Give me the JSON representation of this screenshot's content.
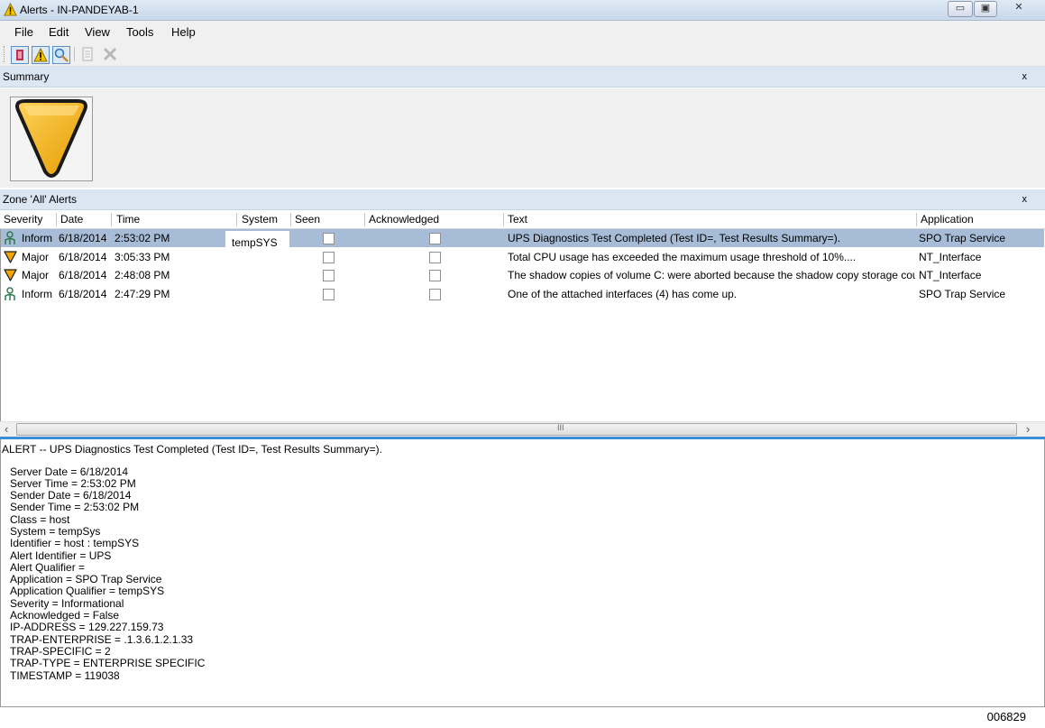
{
  "window": {
    "title": "Alerts - IN-PANDEYAB-1"
  },
  "menu": [
    "File",
    "Edit",
    "View",
    "Tools",
    "Help"
  ],
  "summary": {
    "title": "Summary",
    "close": "x"
  },
  "alerts_panel": {
    "title": "Zone 'All' Alerts",
    "close": "x"
  },
  "columns": [
    "Severity",
    "Date",
    "Time",
    "System",
    "Seen",
    "Acknowledged",
    "Text",
    "Application"
  ],
  "rows": [
    {
      "severity": "Inform",
      "date": "6/18/2014",
      "time": "2:53:02 PM",
      "system": "tempSYS",
      "text": "UPS Diagnostics Test Completed (Test ID=, Test Results Summary=).",
      "application": "SPO Trap Service",
      "selected": true
    },
    {
      "severity": "Major",
      "date": "6/18/2014",
      "time": "3:05:33 PM",
      "system": "",
      "text": "Total CPU usage has exceeded the maximum usage threshold of 10%....",
      "application": "NT_Interface",
      "selected": false
    },
    {
      "severity": "Major",
      "date": "6/18/2014",
      "time": "2:48:08 PM",
      "system": "",
      "text": "The shadow copies of volume C: were aborted because the shadow copy storage coul...",
      "application": "NT_Interface",
      "selected": false
    },
    {
      "severity": "Inform",
      "date": "6/18/2014",
      "time": "2:47:29 PM",
      "system": "",
      "text": "One of the attached interfaces (4) has come up.",
      "application": "SPO Trap Service",
      "selected": false
    }
  ],
  "scroll": {
    "left": "‹",
    "right": "›",
    "grip": "III"
  },
  "detail": {
    "header": "ALERT -- UPS Diagnostics Test Completed (Test ID=, Test Results Summary=).",
    "lines": [
      "Server Date  =  6/18/2014",
      "Server Time  =  2:53:02 PM",
      "Sender Date  =  6/18/2014",
      "Sender Time  =  2:53:02 PM",
      "Class  =  host",
      "System  =  tempSys",
      "Identifier  =  host :  tempSYS",
      "Alert Identifier  =  UPS",
      "Alert Qualifier  =",
      "Application  =  SPO Trap Service",
      "Application Qualifier  =   tempSYS",
      "Severity  =  Informational",
      "Acknowledged  =  False",
      "IP-ADDRESS  =  129.227.159.73",
      "TRAP-ENTERPRISE  =  .1.3.6.1.2.1.33",
      "TRAP-SPECIFIC  =  2",
      "TRAP-TYPE  =  ENTERPRISE SPECIFIC",
      "TIMESTAMP  =  119038"
    ]
  },
  "footer_id": "006829",
  "icons": {
    "app": "warning-icon",
    "inform": "inform-person-icon",
    "major": "major-triangle-icon"
  },
  "colors": {
    "selected_row": "#a7bcd6",
    "panel_header": "#dbe6f3",
    "major": "#f0a800",
    "accent_line": "#3b8fd9"
  }
}
